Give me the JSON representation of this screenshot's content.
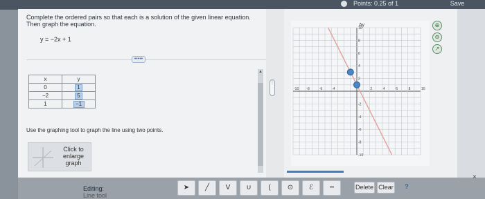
{
  "header": {
    "points_text": "Points: 0.25 of 1",
    "save_label": "Save"
  },
  "question": {
    "prompt": "Complete the ordered pairs so that each is a solution of the given linear equation. Then graph the equation.",
    "equation": "y = −2x + 1",
    "more_label": "•••••"
  },
  "table": {
    "headers": [
      "x",
      "y"
    ],
    "rows": [
      {
        "x": "0",
        "y": "1"
      },
      {
        "x": "−2",
        "y": "5"
      },
      {
        "x": "1",
        "y": "−1"
      }
    ]
  },
  "instruction": "Use the graphing tool to graph the line using two points.",
  "enlarge_label_1": "Click to",
  "enlarge_label_2": "enlarge",
  "enlarge_label_3": "graph",
  "graph": {
    "y_axis_label": "Ay",
    "x_ticks": [
      "-10",
      "-8",
      "-6",
      "-4",
      "2",
      "4",
      "6",
      "8",
      "10"
    ],
    "y_ticks": [
      "10",
      "8",
      "6",
      "4",
      "2",
      "-2",
      "-4",
      "-6",
      "-8",
      "-10"
    ],
    "line": {
      "slope": -2,
      "intercept": 1
    },
    "points": [
      {
        "x": 0,
        "y": 1
      },
      {
        "x": -1,
        "y": 3
      }
    ]
  },
  "toolbar": {
    "editing_label": "Editing:",
    "editing_value": "Line tool",
    "delete_label": "Delete",
    "clear_label": "Clear",
    "help_label": "?",
    "close_label": "×"
  },
  "colors": {
    "accent": "#3d7fc2",
    "graph_line": "#e0a7a1",
    "point": "#4a86c5"
  }
}
